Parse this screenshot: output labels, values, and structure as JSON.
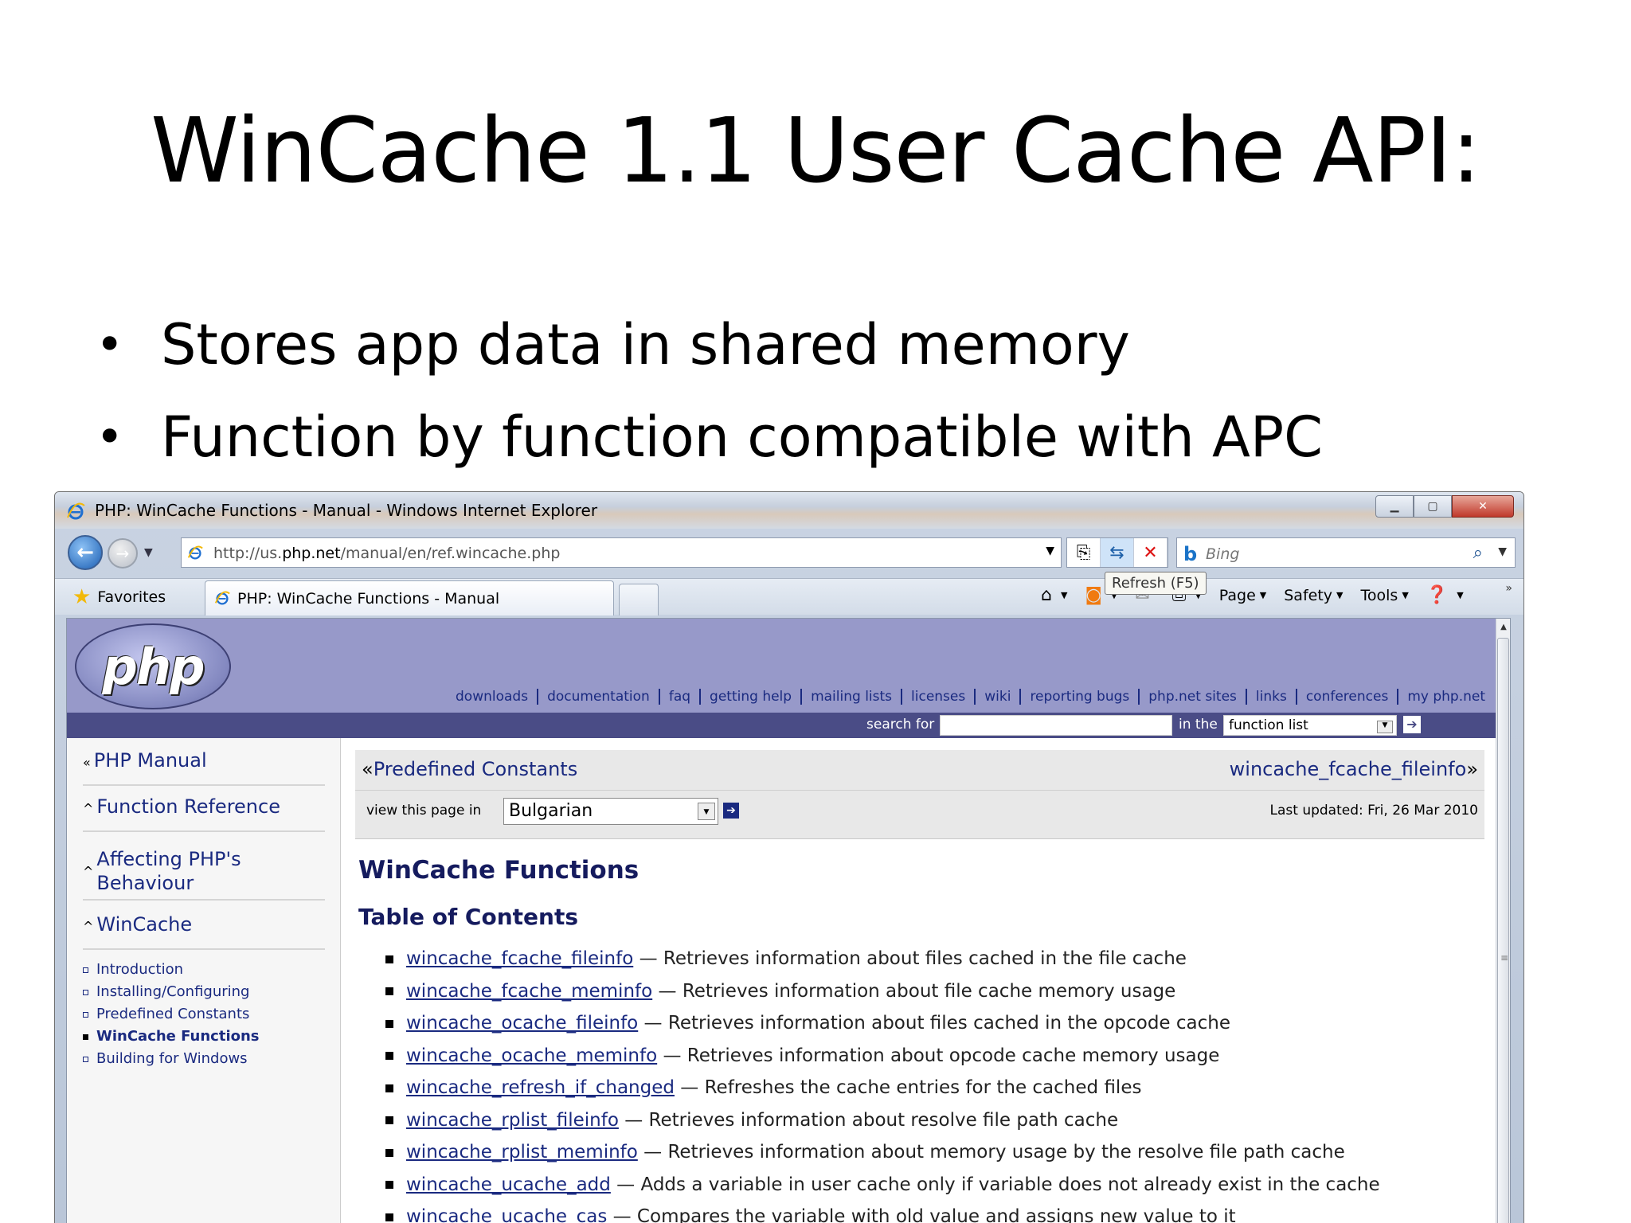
{
  "slide": {
    "title": "WinCache 1.1 User Cache API:",
    "bullets": [
      "Stores app data in shared memory",
      "Function by function compatible with APC"
    ]
  },
  "browser": {
    "window_title": "PHP: WinCache Functions - Manual - Windows Internet Explorer",
    "address_url_prefix": "http://us.",
    "address_url_domain": "php.net",
    "address_url_path": "/manual/en/ref.wincache.php",
    "search_placeholder": "Bing",
    "tooltip": "Refresh (F5)",
    "favorites_label": "Favorites",
    "tab_label": "PHP: WinCache Functions - Manual",
    "commands": [
      {
        "label": "Page",
        "icon": "page-icon"
      },
      {
        "label": "Safety",
        "icon": "safety-icon"
      },
      {
        "label": "Tools",
        "icon": "tools-icon"
      }
    ]
  },
  "php": {
    "logo_text": "php",
    "nav": [
      "downloads",
      "documentation",
      "faq",
      "getting help",
      "mailing lists",
      "licenses",
      "wiki",
      "reporting bugs",
      "php.net sites",
      "links",
      "conferences",
      "my php.net"
    ],
    "search_for_label": "search for",
    "in_the_label": "in the",
    "in_the_value": "function list"
  },
  "sidebar": {
    "items": [
      {
        "label": "PHP Manual",
        "caret": "«"
      },
      {
        "label": "Function Reference",
        "caret": "^"
      },
      {
        "label": "Affecting PHP's Behaviour",
        "caret": "^"
      },
      {
        "label": "WinCache",
        "caret": "^"
      }
    ],
    "sub_items": [
      {
        "label": "Introduction",
        "active": false
      },
      {
        "label": "Installing/Configuring",
        "active": false
      },
      {
        "label": "Predefined Constants",
        "active": false
      },
      {
        "label": "WinCache Functions",
        "active": true
      },
      {
        "label": "Building for Windows",
        "active": false
      }
    ]
  },
  "main": {
    "prev_glyph": "«",
    "prev_label": "Predefined Constants",
    "next_label": "wincache_fcache_fileinfo",
    "next_glyph": "»",
    "view_in_label": "view this page in",
    "language_value": "Bulgarian",
    "last_updated": "Last updated: Fri, 26 Mar 2010",
    "heading": "WinCache Functions",
    "toc_heading": "Table of Contents",
    "toc": [
      {
        "name": "wincache_fcache_fileinfo",
        "desc": " — Retrieves information about files cached in the file cache"
      },
      {
        "name": "wincache_fcache_meminfo",
        "desc": " — Retrieves information about file cache memory usage"
      },
      {
        "name": "wincache_ocache_fileinfo",
        "desc": " — Retrieves information about files cached in the opcode cache"
      },
      {
        "name": "wincache_ocache_meminfo",
        "desc": " — Retrieves information about opcode cache memory usage"
      },
      {
        "name": "wincache_refresh_if_changed",
        "desc": " — Refreshes the cache entries for the cached files"
      },
      {
        "name": "wincache_rplist_fileinfo",
        "desc": " — Retrieves information about resolve file path cache"
      },
      {
        "name": "wincache_rplist_meminfo",
        "desc": " — Retrieves information about memory usage by the resolve file path cache"
      },
      {
        "name": "wincache_ucache_add",
        "desc": " — Adds a variable in user cache only if variable does not already exist in the cache"
      },
      {
        "name": "wincache_ucache_cas",
        "desc": " — Compares the variable with old value and assigns new value to it"
      }
    ]
  }
}
